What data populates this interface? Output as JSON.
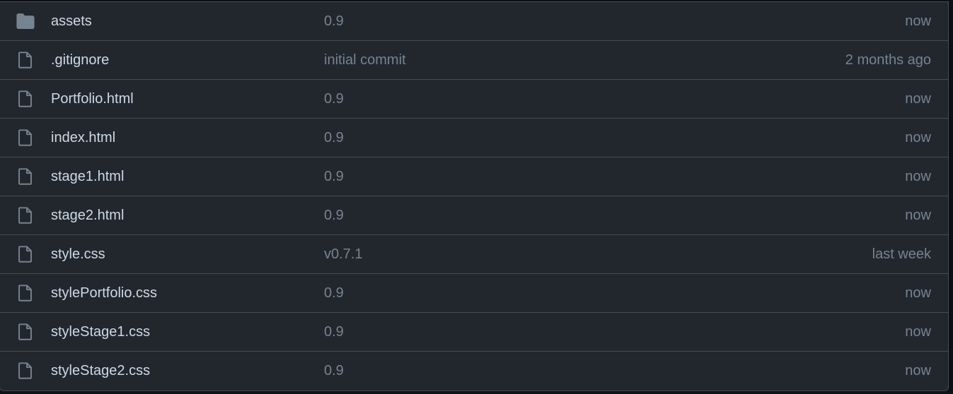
{
  "colors": {
    "background": "#22272e",
    "border": "#444c56",
    "name_text": "#cdd9e5",
    "muted_text": "#768390",
    "icon_color": "#768390"
  },
  "files": [
    {
      "type": "folder",
      "icon": "folder-icon",
      "name": "assets",
      "commit": "0.9",
      "age": "now"
    },
    {
      "type": "file",
      "icon": "file-icon",
      "name": ".gitignore",
      "commit": "initial commit",
      "age": "2 months ago"
    },
    {
      "type": "file",
      "icon": "file-icon",
      "name": "Portfolio.html",
      "commit": "0.9",
      "age": "now"
    },
    {
      "type": "file",
      "icon": "file-icon",
      "name": "index.html",
      "commit": "0.9",
      "age": "now"
    },
    {
      "type": "file",
      "icon": "file-icon",
      "name": "stage1.html",
      "commit": "0.9",
      "age": "now"
    },
    {
      "type": "file",
      "icon": "file-icon",
      "name": "stage2.html",
      "commit": "0.9",
      "age": "now"
    },
    {
      "type": "file",
      "icon": "file-icon",
      "name": "style.css",
      "commit": "v0.7.1",
      "age": "last week"
    },
    {
      "type": "file",
      "icon": "file-icon",
      "name": "stylePortfolio.css",
      "commit": "0.9",
      "age": "now"
    },
    {
      "type": "file",
      "icon": "file-icon",
      "name": "styleStage1.css",
      "commit": "0.9",
      "age": "now"
    },
    {
      "type": "file",
      "icon": "file-icon",
      "name": "styleStage2.css",
      "commit": "0.9",
      "age": "now"
    }
  ]
}
